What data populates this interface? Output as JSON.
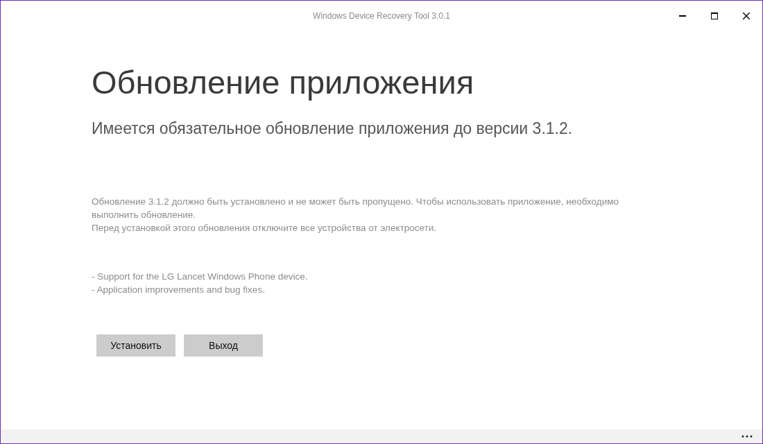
{
  "window": {
    "title": "Windows Device Recovery Tool 3.0.1"
  },
  "heading": "Обновление приложения",
  "subtitle": "Имеется обязательное обновление приложения до версии 3.1.2.",
  "description": [
    "Обновление 3.1.2 должно быть установлено и не может быть пропущено. Чтобы использовать приложение, необходимо выполнить обновление.",
    "Перед установкой этого обновления отключите все устройства от электросети."
  ],
  "changes": [
    "- Support for the LG Lancet Windows Phone device.",
    "- Application improvements and bug fixes."
  ],
  "buttons": [
    "Установить",
    "Выход"
  ]
}
